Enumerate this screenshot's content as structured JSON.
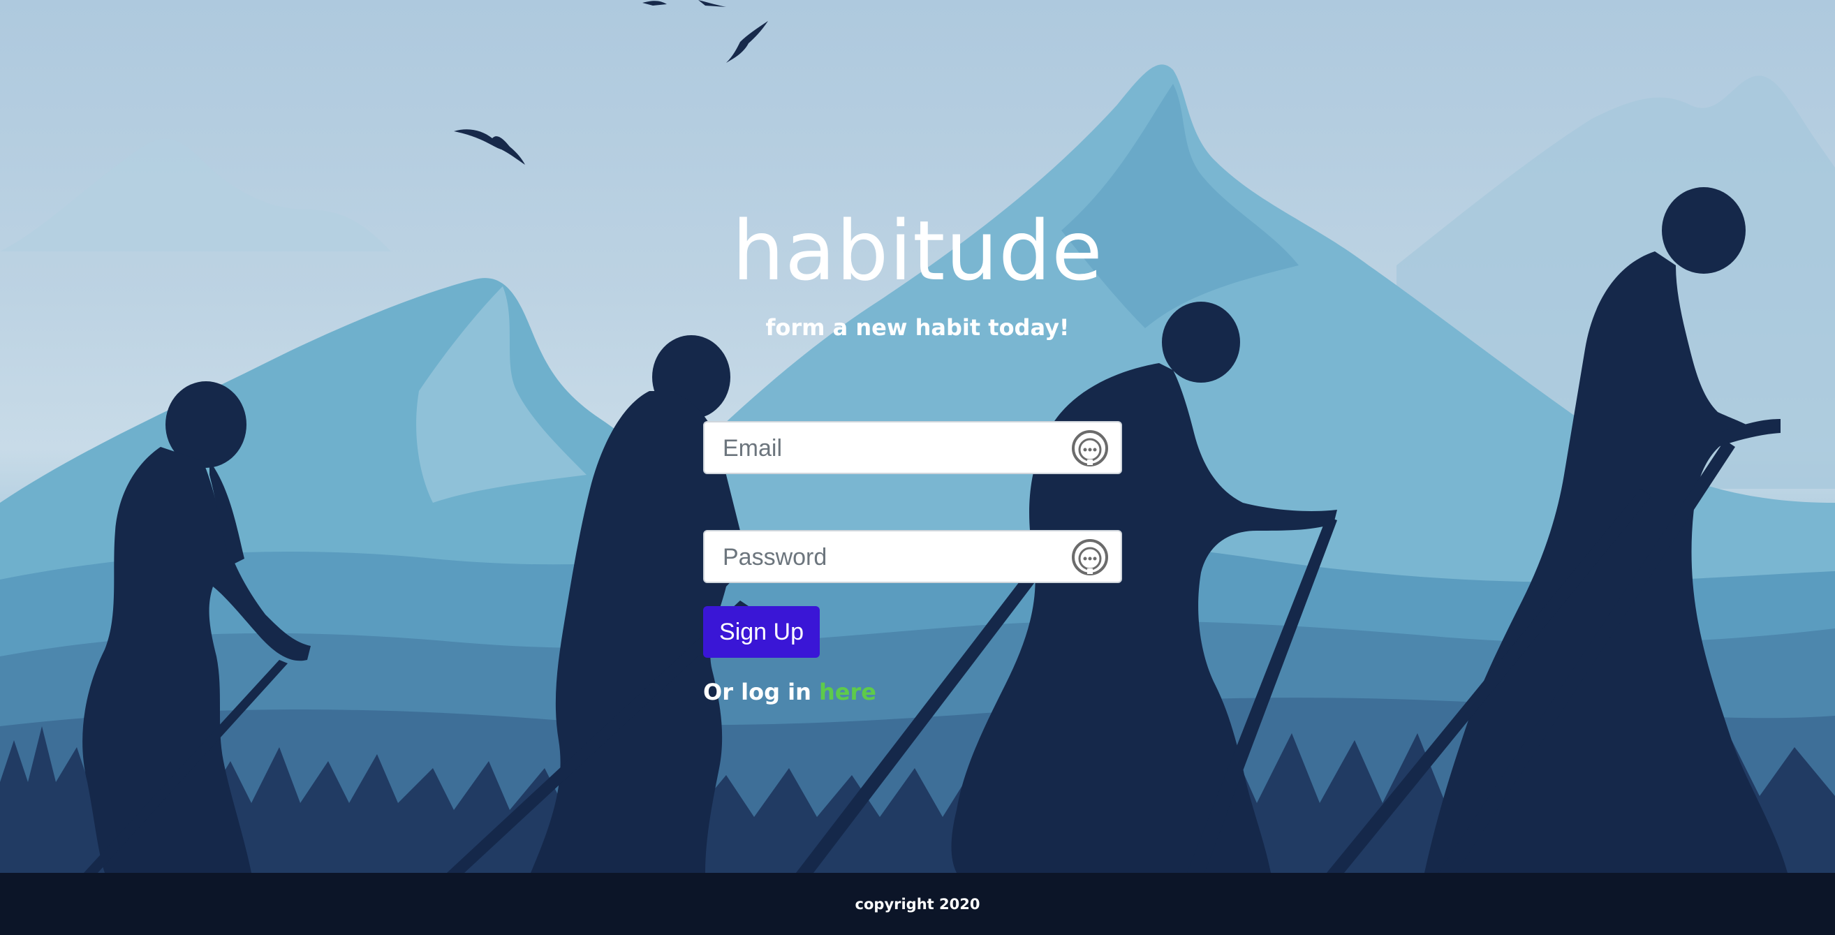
{
  "brand": {
    "title": "habitude",
    "tagline": "form a new habit today!"
  },
  "form": {
    "email": {
      "placeholder": "Email",
      "value": "",
      "icon": "ellipsis-circle-icon"
    },
    "password": {
      "placeholder": "Password",
      "value": "",
      "icon": "ellipsis-circle-icon"
    },
    "signup_label": "Sign Up"
  },
  "login_prompt": {
    "text": "Or log in ",
    "link_text": "here"
  },
  "footer": {
    "text": "copyright 2020"
  },
  "colors": {
    "sky": "#aec9de",
    "mountain_light": "#7fb8d2",
    "mountain_mid": "#5b9bbd",
    "silhouette": "#15284a",
    "button": "#3a16d6",
    "link": "#5ecb4a",
    "footer": "#0c1528"
  }
}
